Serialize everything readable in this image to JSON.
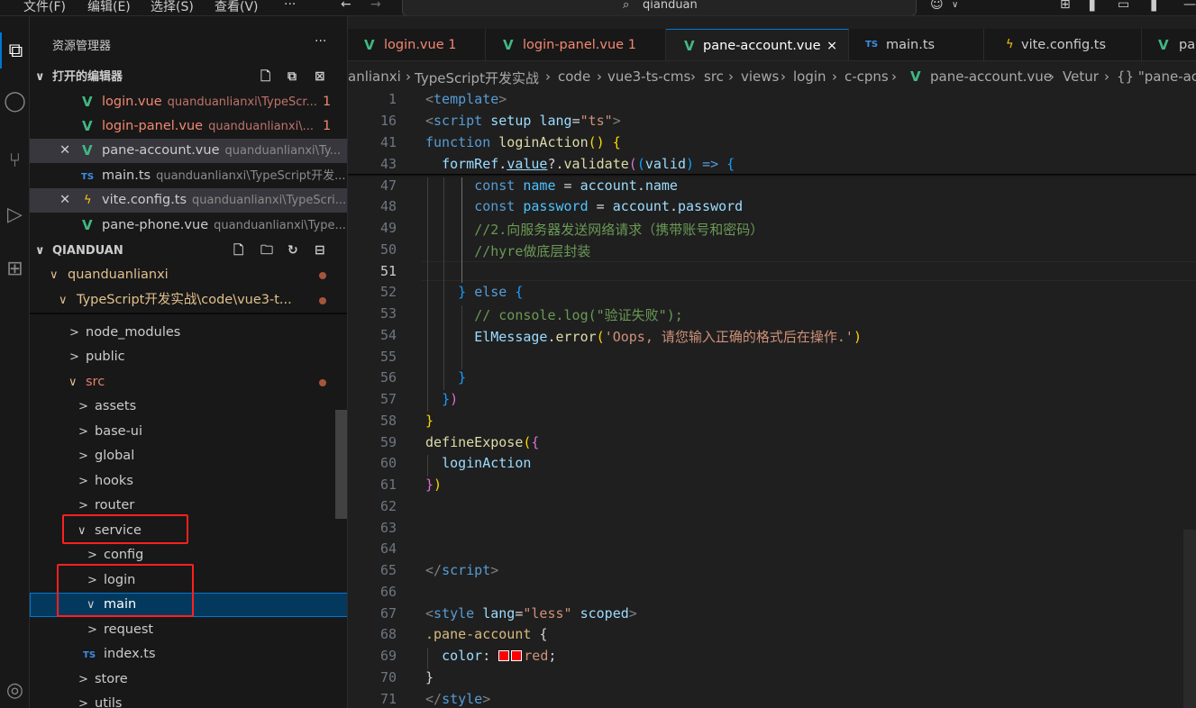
{
  "titlebar": {
    "menus": [
      "文件(F)",
      "编辑(E)",
      "选择(S)",
      "查看(V)",
      "···"
    ],
    "search": "qianduan"
  },
  "activity": {
    "icons": [
      "explorer-icon",
      "search-icon",
      "source-control-icon",
      "run-debug-icon",
      "extensions-icon",
      "account-icon"
    ]
  },
  "sidebar": {
    "title": "资源管理器",
    "more": "···",
    "open_editors_header": "打开的编辑器",
    "open_editors": [
      {
        "name": "login.vue",
        "path": "quanduanlianxi\\TypeScr...",
        "badge": "1",
        "icon": "vue"
      },
      {
        "name": "login-panel.vue",
        "path": "quanduanlianxi\\...",
        "badge": "1",
        "icon": "vue"
      },
      {
        "name": "pane-account.vue",
        "path": "quanduanlianxi\\Ty...",
        "badge": "",
        "icon": "vue"
      },
      {
        "name": "main.ts",
        "path": "quanduanlianxi\\TypeScript开发...",
        "badge": "",
        "icon": "ts"
      },
      {
        "name": "vite.config.ts",
        "path": "quanduanlianxi\\TypeScri...",
        "badge": "",
        "icon": "vite"
      },
      {
        "name": "pane-phone.vue",
        "path": "quanduanlianxi\\Type...",
        "badge": "",
        "icon": "vue"
      }
    ],
    "workspace_header": "QIANDUAN",
    "tree": [
      {
        "label": "quanduanlianxi"
      },
      {
        "label": "TypeScript开发实战\\code\\vue3-t..."
      },
      {
        "label": "node_modules"
      },
      {
        "label": "public"
      },
      {
        "label": "src"
      },
      {
        "label": "assets"
      },
      {
        "label": "base-ui"
      },
      {
        "label": "global"
      },
      {
        "label": "hooks"
      },
      {
        "label": "router"
      },
      {
        "label": "service"
      },
      {
        "label": "config"
      },
      {
        "label": "login"
      },
      {
        "label": "main"
      },
      {
        "label": "request"
      },
      {
        "label": "index.ts"
      },
      {
        "label": "store"
      },
      {
        "label": "utils"
      }
    ],
    "ts_badge": "TS"
  },
  "tabs": [
    {
      "label": "login.vue",
      "badge": "1"
    },
    {
      "label": "login-panel.vue",
      "badge": "1"
    },
    {
      "label": "pane-account.vue",
      "badge": "×"
    },
    {
      "label": "main.ts",
      "badge": ""
    },
    {
      "label": "vite.config.ts",
      "badge": ""
    },
    {
      "label": "pan",
      "badge": ""
    }
  ],
  "breadcrumb": [
    "anlianxi",
    "TypeScript开发实战",
    "code",
    "vue3-ts-cms",
    "src",
    "views",
    "login",
    "c-cpns",
    "pane-account.vue",
    "Vetur",
    "{} \"pane-ac"
  ],
  "editor": {
    "line_numbers": [
      "1",
      "16",
      "41",
      "43",
      "47",
      "48",
      "49",
      "50",
      "51",
      "52",
      "53",
      "54",
      "55",
      "56",
      "57",
      "58",
      "59",
      "60",
      "61",
      "62",
      "63",
      "64",
      "65",
      "66",
      "67",
      "68",
      "69",
      "70",
      "71"
    ],
    "code": {
      "l1": [
        "<",
        "template",
        ">"
      ],
      "l16": [
        "<",
        "script",
        "setup",
        "lang",
        "=",
        "\"ts\"",
        ">"
      ],
      "l41": [
        "function",
        "loginAction",
        "()",
        "{"
      ],
      "l43": [
        "formRef",
        ".",
        "value",
        "?.",
        "validate",
        "(",
        "(",
        "valid",
        ")",
        "=>",
        "{"
      ],
      "l47": [
        "const",
        "name",
        "=",
        "account",
        ".",
        "name"
      ],
      "l48": [
        "const",
        "password",
        "=",
        "account",
        ".",
        "password"
      ],
      "l49": "//2.向服务器发送网络请求（携带账号和密码）",
      "l50": "//hyre做底层封装",
      "l52": [
        "}",
        "else",
        "{"
      ],
      "l53": "// console.log(\"验证失败\");",
      "l54": [
        "ElMessage",
        ".",
        "error",
        "(",
        "'Oops, 请您输入正确的格式后在操作.'",
        ")"
      ],
      "l56": "}",
      "l57": [
        "}",
        ")"
      ],
      "l58": "}",
      "l59": [
        "defineExpose",
        "(",
        "{"
      ],
      "l60": "loginAction",
      "l61": [
        "}",
        ")"
      ],
      "l65": [
        "</",
        "script",
        ">"
      ],
      "l67": [
        "<",
        "style",
        "lang",
        "=",
        "\"less\"",
        "scoped",
        ">"
      ],
      "l68": [
        ".pane-account",
        "{"
      ],
      "l69": [
        "color",
        ":",
        "red",
        ";"
      ],
      "l70": "}",
      "l71": [
        "</",
        "style",
        ">"
      ]
    }
  },
  "colors": {
    "vue": "#41b883",
    "ts": "#3b8eea",
    "modified": "#e2c08d",
    "error": "#f48771",
    "highlight_box": "#ff2020",
    "accent": "#0078d4"
  }
}
